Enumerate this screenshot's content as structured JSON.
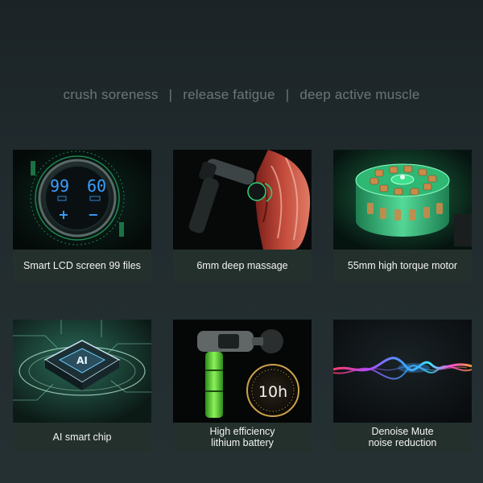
{
  "tagline": {
    "part1": "crush soreness",
    "sep1": "|",
    "part2": "release fatigue",
    "sep2": "|",
    "part3": "deep active muscle"
  },
  "features": [
    {
      "label": "Smart LCD screen 99 files",
      "icon": "lcd-screen-icon",
      "lcd": {
        "left": "99",
        "right": "60",
        "plus": "+",
        "minus": "−"
      }
    },
    {
      "label": "6mm deep massage",
      "icon": "massage-gun-muscle-icon"
    },
    {
      "label": "55mm high torque motor",
      "icon": "motor-icon"
    },
    {
      "label": "AI smart chip",
      "icon": "chip-icon",
      "chip_text": "AI"
    },
    {
      "label_line1": "High efficiency",
      "label_line2": "lithium battery",
      "icon": "battery-icon",
      "badge": "10h"
    },
    {
      "label_line1": "Denoise Mute",
      "label_line2": "noise reduction",
      "icon": "soundwave-icon"
    }
  ],
  "colors": {
    "background": "#1e272a",
    "tagline": "#6c7679",
    "card_label_bg": "#23302c",
    "accent_green": "#2fd27a",
    "lcd_blue": "#3aa0ff"
  }
}
